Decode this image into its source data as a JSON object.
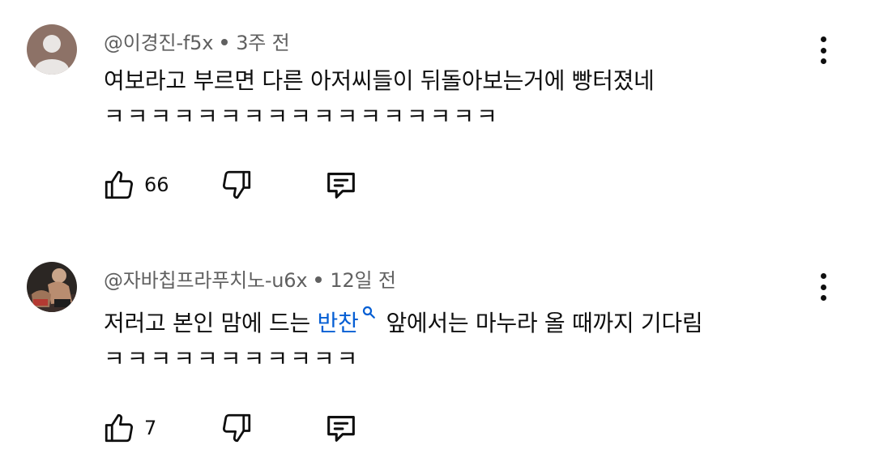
{
  "comments": [
    {
      "author": "@이경진-f5x",
      "time": "3주 전",
      "line1": "여보라고 부르면 다른 아저씨들이 뒤돌아보는거에 빵터졌네",
      "line2": "ㅋㅋㅋㅋㅋㅋㅋㅋㅋㅋㅋㅋㅋㅋㅋㅋㅋ",
      "likes": "66",
      "avatar_color": "#8d7267"
    },
    {
      "author": "@자바칩프라푸치노-u6x",
      "time": "12일 전",
      "line1_before": "저러고 본인 맘에 드는 ",
      "line1_link": "반찬",
      "line1_after": "앞에서는 마누라 올 때까지 기다림",
      "line2": "ㅋㅋㅋㅋㅋㅋㅋㅋㅋㅋㅋ",
      "likes": "7",
      "link_color": "#065fd4"
    }
  ],
  "icons": [
    "person-avatar-icon",
    "photo-avatar-icon",
    "thumb-up-icon",
    "thumb-down-icon",
    "reply-comment-icon",
    "search-icon",
    "more-vert-icon"
  ]
}
